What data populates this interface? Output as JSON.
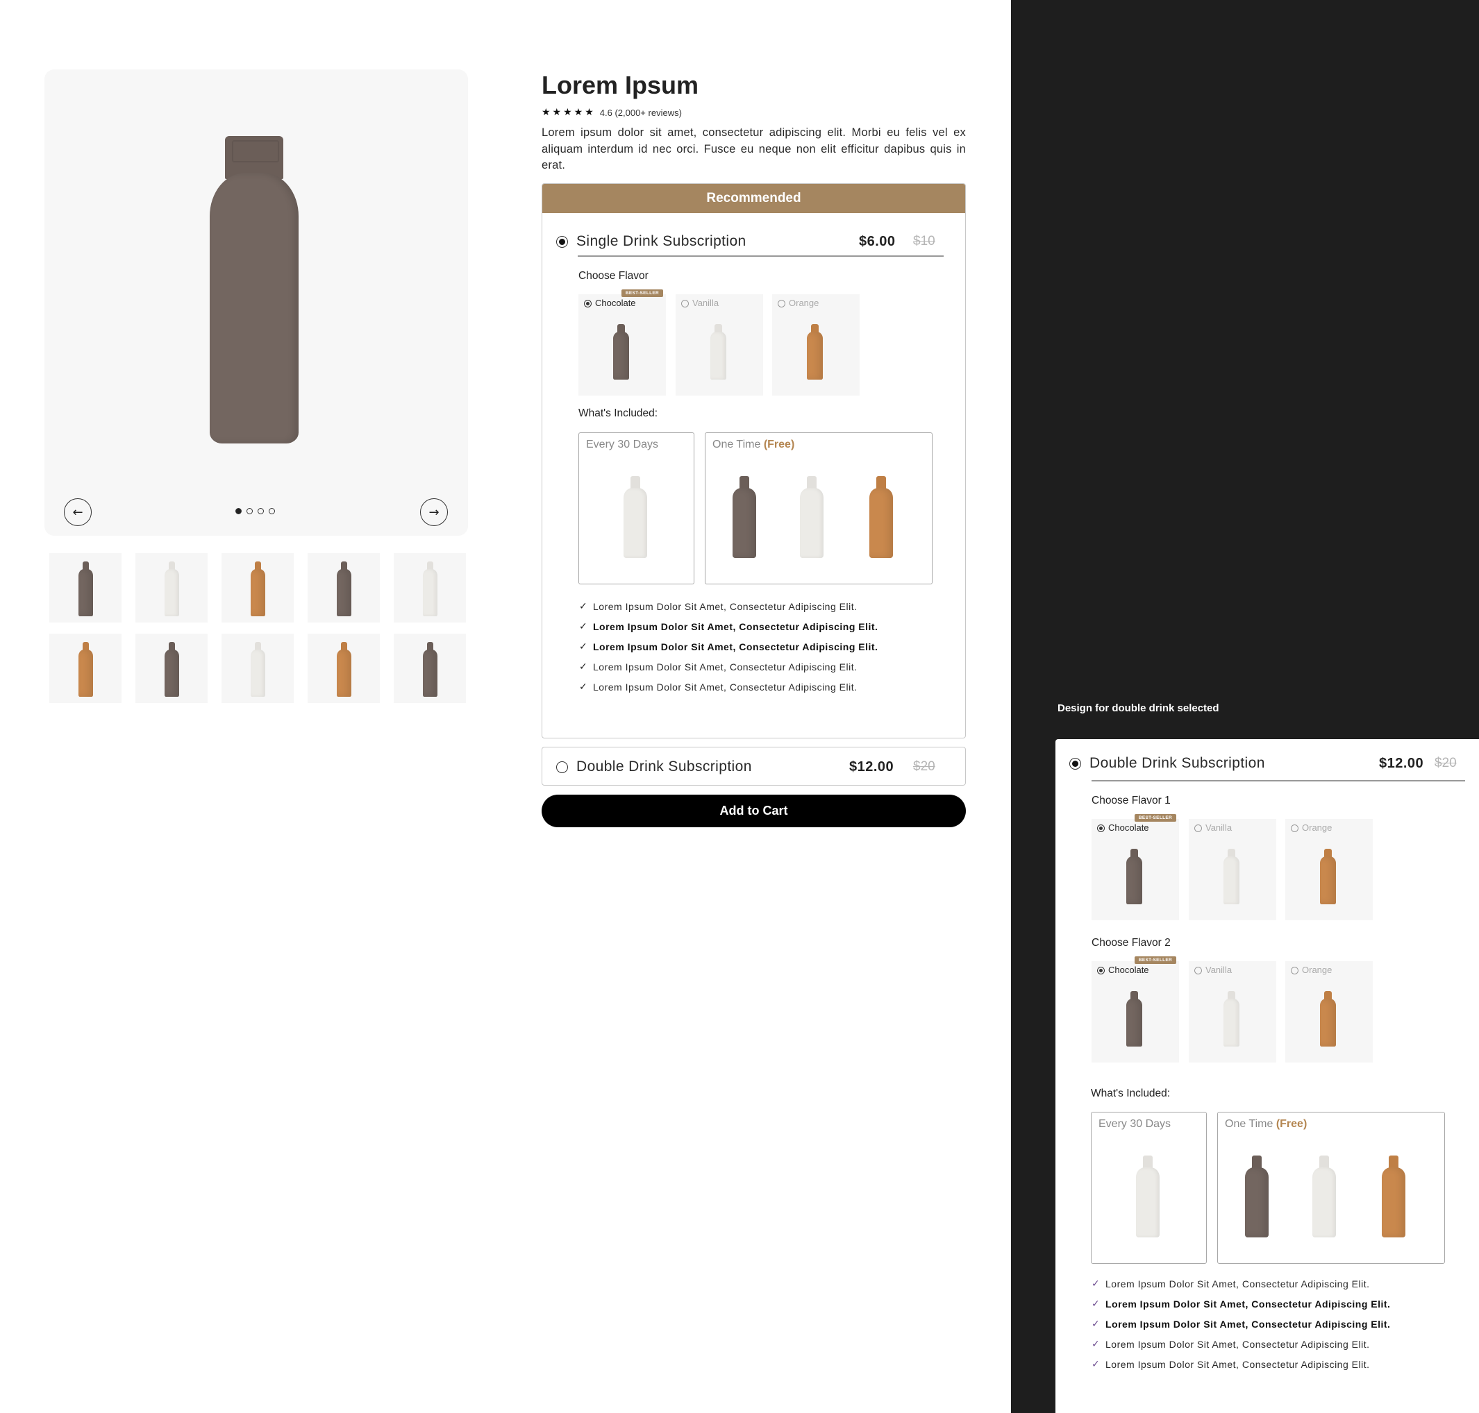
{
  "product": {
    "title": "Lorem Ipsum",
    "stars": "★★★★★",
    "rating": "4.6 (2,000+ reviews)",
    "description": "Lorem ipsum dolor sit amet, consectetur adipiscing elit. Morbi eu felis vel ex aliquam interdum id nec orci. Fusce eu neque non elit efficitur dapibus quis in erat."
  },
  "gallery": {
    "prev_icon": "arrow-left-icon",
    "next_icon": "arrow-right-icon",
    "prev_glyph": "←",
    "next_glyph": "→",
    "slide_count": 4,
    "active_slide": 1,
    "thumbnails": [
      "chocolate",
      "vanilla",
      "orange",
      "chocolate",
      "vanilla",
      "orange",
      "chocolate",
      "vanilla",
      "orange",
      "chocolate"
    ]
  },
  "recommended": {
    "header": "Recommended",
    "single": {
      "name": "Single Drink Subscription",
      "price": "$6.00",
      "old_price": "$10",
      "selected": true
    },
    "choose_flavor_label": "Choose Flavor",
    "best_seller": "BEST-SELLER",
    "flavors": [
      {
        "name": "Chocolate",
        "selected": true
      },
      {
        "name": "Vanilla",
        "selected": false
      },
      {
        "name": "Orange",
        "selected": false
      }
    ],
    "included_label": "What's Included:",
    "every_label": "Every 30 Days",
    "one_time_label": "One Time",
    "free_label": "(Free)",
    "bullets": [
      {
        "text": "Lorem Ipsum Dolor Sit Amet, Consectetur Adipiscing Elit.",
        "bold": false
      },
      {
        "text": "Lorem Ipsum Dolor Sit Amet, Consectetur Adipiscing Elit.",
        "bold": true
      },
      {
        "text": "Lorem Ipsum Dolor Sit Amet, Consectetur Adipiscing Elit.",
        "bold": true
      },
      {
        "text": "Lorem Ipsum Dolor Sit Amet, Consectetur Adipiscing Elit.",
        "bold": false
      },
      {
        "text": "Lorem Ipsum Dolor Sit Amet, Consectetur Adipiscing Elit.",
        "bold": false
      }
    ]
  },
  "double": {
    "name": "Double Drink Subscription",
    "price": "$12.00",
    "old_price": "$20",
    "selected": false
  },
  "cart": {
    "label": "Add to Cart"
  },
  "alt_panel": {
    "caption": "Design for double drink selected",
    "name": "Double Drink Subscription",
    "price": "$12.00",
    "old_price": "$20",
    "flavor1_label": "Choose Flavor 1",
    "flavor2_label": "Choose Flavor 2",
    "included_label": "What's Included:",
    "every_label": "Every 30 Days",
    "one_time_label": "One Time",
    "free_label": "(Free)"
  },
  "colors": {
    "accent": "#a58660",
    "chocolate": "#736660",
    "vanilla": "#ecebe7",
    "orange": "#c9884d",
    "dark_panel": "#1e1e1e"
  }
}
